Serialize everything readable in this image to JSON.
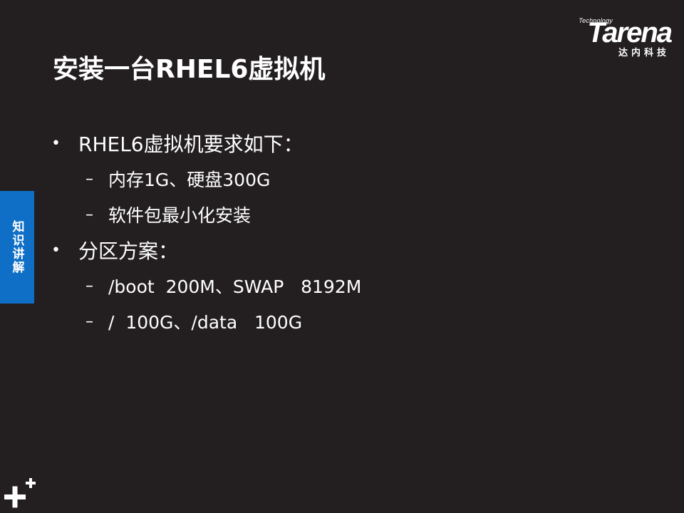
{
  "logo": {
    "small_text": "Technology",
    "wordmark": "Tarena",
    "chinese": "达内科技"
  },
  "title": "安装一台RHEL6虚拟机",
  "side_tab": "知识讲解",
  "bullets": [
    {
      "text": "RHEL6虚拟机要求如下：",
      "subs": [
        "内存1G、硬盘300G",
        "软件包最小化安装"
      ]
    },
    {
      "text": "分区方案：",
      "subs": [
        "/boot  200M、SWAP   8192M",
        "/  100G、/data   100G"
      ]
    }
  ],
  "symbols": {
    "bullet": "•",
    "dash": "–"
  },
  "colors": {
    "background": "#231f20",
    "accent_blue": "#0f6fc6",
    "text": "#ffffff"
  }
}
